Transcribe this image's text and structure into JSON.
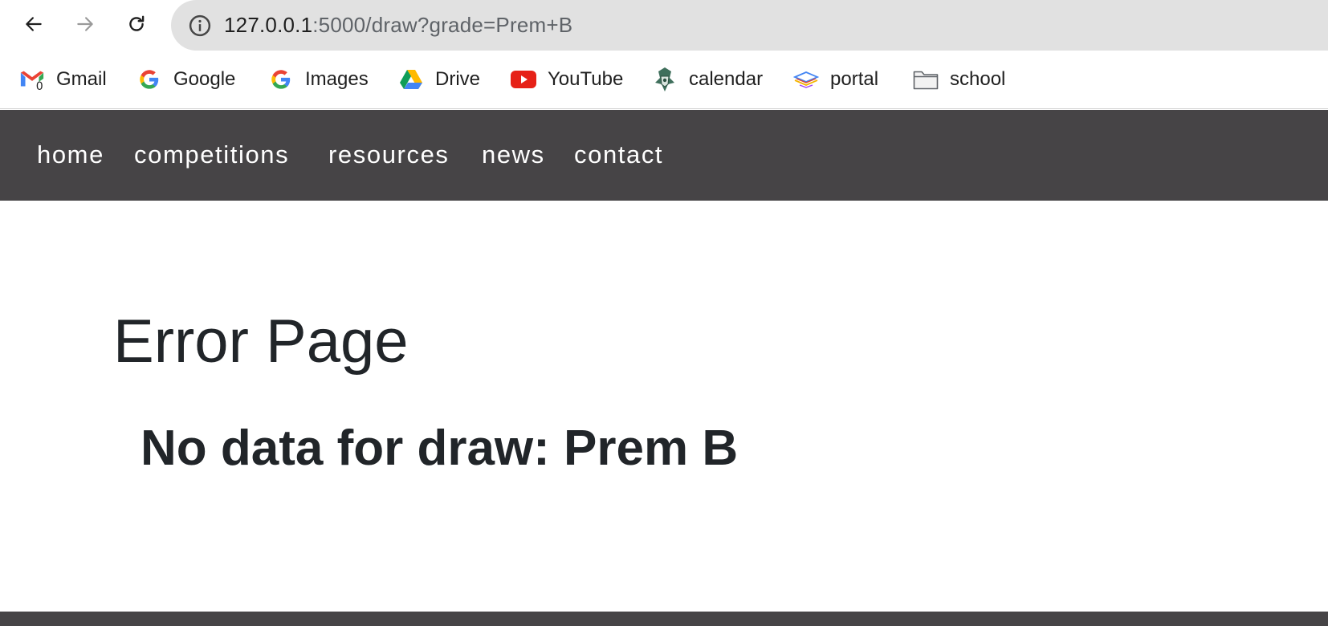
{
  "browser": {
    "url_host": "127.0.0.1",
    "url_path": ":5000/draw?grade=Prem+B"
  },
  "bookmarks": [
    {
      "label": "Gmail",
      "icon": "gmail-icon"
    },
    {
      "label": "Google",
      "icon": "google-icon"
    },
    {
      "label": "Images",
      "icon": "google-icon"
    },
    {
      "label": "Drive",
      "icon": "drive-icon"
    },
    {
      "label": "YouTube",
      "icon": "youtube-icon"
    },
    {
      "label": "calendar",
      "icon": "crest-icon"
    },
    {
      "label": "portal",
      "icon": "layers-icon"
    },
    {
      "label": "school",
      "icon": "folder-icon"
    }
  ],
  "gmail_badge": "0",
  "nav": {
    "items": [
      "home",
      "competitions",
      "resources",
      "news",
      "contact"
    ]
  },
  "main": {
    "title": "Error Page",
    "message": "No data for draw: Prem B"
  },
  "colors": {
    "nav_bg": "#464446",
    "text": "#212529",
    "omnibox_bg": "#e1e1e1"
  }
}
